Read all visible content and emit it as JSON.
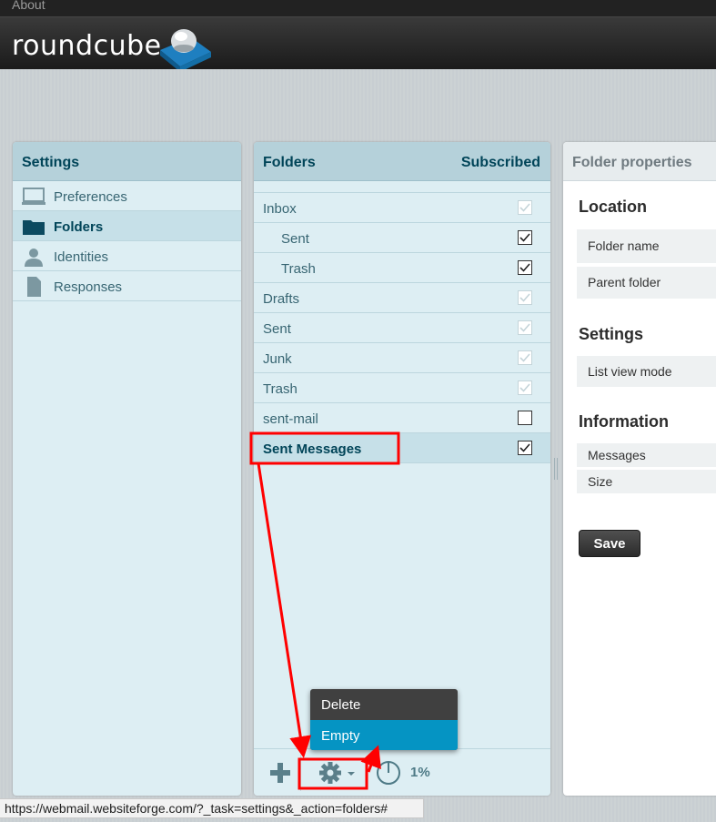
{
  "topbar": {
    "about_label": "About"
  },
  "header": {
    "logo_text": "roundcube"
  },
  "settings_panel": {
    "title": "Settings",
    "items": [
      {
        "label": "Preferences",
        "icon": "monitor-icon",
        "selected": false
      },
      {
        "label": "Folders",
        "icon": "folder-icon",
        "selected": true
      },
      {
        "label": "Identities",
        "icon": "person-icon",
        "selected": false
      },
      {
        "label": "Responses",
        "icon": "document-icon",
        "selected": false
      }
    ]
  },
  "folders_panel": {
    "title": "Folders",
    "subscribed_label": "Subscribed",
    "rows": [
      {
        "name": "Inbox",
        "sub": false,
        "checked": true,
        "disabled": true,
        "selected": false
      },
      {
        "name": "Sent",
        "sub": true,
        "checked": true,
        "disabled": false,
        "selected": false
      },
      {
        "name": "Trash",
        "sub": true,
        "checked": true,
        "disabled": false,
        "selected": false
      },
      {
        "name": "Drafts",
        "sub": false,
        "checked": true,
        "disabled": true,
        "selected": false
      },
      {
        "name": "Sent",
        "sub": false,
        "checked": true,
        "disabled": true,
        "selected": false
      },
      {
        "name": "Junk",
        "sub": false,
        "checked": true,
        "disabled": true,
        "selected": false
      },
      {
        "name": "Trash",
        "sub": false,
        "checked": true,
        "disabled": true,
        "selected": false
      },
      {
        "name": "sent-mail",
        "sub": false,
        "checked": false,
        "disabled": false,
        "selected": false
      },
      {
        "name": "Sent Messages",
        "sub": false,
        "checked": true,
        "disabled": false,
        "selected": true
      }
    ],
    "footer": {
      "quota": "1%"
    }
  },
  "popup_menu": {
    "items": [
      {
        "label": "Delete",
        "active": false
      },
      {
        "label": "Empty",
        "active": true
      }
    ]
  },
  "properties_panel": {
    "title": "Folder properties",
    "location_heading": "Location",
    "folder_name_label": "Folder name",
    "parent_folder_label": "Parent folder",
    "settings_heading": "Settings",
    "list_view_mode_label": "List view mode",
    "information_heading": "Information",
    "messages_label": "Messages",
    "size_label": "Size",
    "save_label": "Save"
  },
  "status_bar": {
    "url": "https://webmail.websiteforge.com/?_task=settings&_action=folders#"
  },
  "colors": {
    "panel_bg": "#ddeef3",
    "panel_header": "#b5d1da",
    "selected_row": "#c6e0e8",
    "menu_active": "#0594c3",
    "annotation_red": "#ff0000"
  }
}
